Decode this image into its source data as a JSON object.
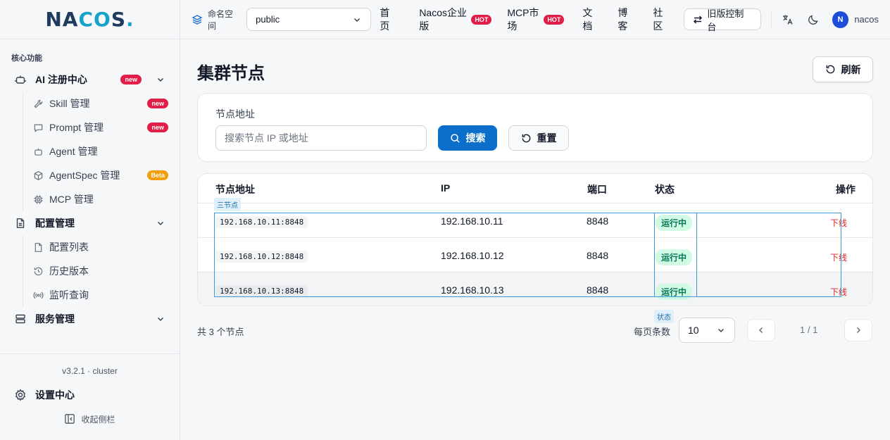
{
  "sidebar": {
    "logo": {
      "n": "N",
      "a": "A",
      "c": "C",
      "o": "O",
      "s": "S",
      "dot": "."
    },
    "section_title": "核心功能",
    "ai_center": {
      "label": "AI 注册中心",
      "badge": "new"
    },
    "ai_items": [
      {
        "label": "Skill 管理",
        "badge": "new",
        "icon": "wrench-icon"
      },
      {
        "label": "Prompt 管理",
        "badge": "new",
        "icon": "chat-icon"
      },
      {
        "label": "Agent 管理",
        "badge": "",
        "icon": "robot-icon"
      },
      {
        "label": "AgentSpec 管理",
        "badge": "Beta",
        "icon": "cube-icon"
      },
      {
        "label": "MCP 管理",
        "badge": "",
        "icon": "chip-icon"
      }
    ],
    "config_group": {
      "label": "配置管理"
    },
    "config_items": [
      {
        "label": "配置列表",
        "icon": "document-icon"
      },
      {
        "label": "历史版本",
        "icon": "history-icon"
      },
      {
        "label": "监听查询",
        "icon": "broadcast-icon"
      }
    ],
    "service_group": {
      "label": "服务管理"
    },
    "version": "v3.2.1 · cluster",
    "settings": "设置中心",
    "collapse": "收起侧栏"
  },
  "header": {
    "namespace_label": "命名空间",
    "namespace_value": "public",
    "nav": {
      "home": [
        "首",
        "页"
      ],
      "enterprise": [
        "Nacos企业",
        "版"
      ],
      "enterprise_badge": "HOT",
      "mcp": [
        "MCP市",
        "场"
      ],
      "mcp_badge": "HOT",
      "docs": [
        "文",
        "档"
      ],
      "blog": [
        "博",
        "客"
      ],
      "community": [
        "社",
        "区"
      ]
    },
    "old_console": "旧版控制台",
    "avatar_letter": "N",
    "username": "nacos"
  },
  "main": {
    "title": "集群节点",
    "refresh": "刷新",
    "search": {
      "label": "节点地址",
      "placeholder": "搜索节点 IP 或地址",
      "search_button": "搜索",
      "reset_button": "重置"
    },
    "table": {
      "headers": [
        "节点地址",
        "IP",
        "端口",
        "状态",
        "操作"
      ],
      "rows": [
        {
          "address": "192.168.10.11:8848",
          "ip": "192.168.10.11",
          "port": "8848",
          "status": "运行中",
          "action": "下线"
        },
        {
          "address": "192.168.10.12:8848",
          "ip": "192.168.10.12",
          "port": "8848",
          "status": "运行中",
          "action": "下线"
        },
        {
          "address": "192.168.10.13:8848",
          "ip": "192.168.10.13",
          "port": "8848",
          "status": "运行中",
          "action": "下线"
        }
      ]
    },
    "overlay_tags": {
      "nodes": "三节点",
      "status": "状态"
    },
    "total": "共 3 个节点",
    "per_page_label": "每页条数",
    "page_size": "10",
    "page_info": "1 / 1"
  },
  "colors": {
    "primary": "#0b6fc9",
    "badge_red": "#e11d48",
    "badge_beta": "#f59e0b",
    "status_green_bg": "#d1fae5",
    "status_green_text": "#047857",
    "danger": "#dc2626"
  }
}
